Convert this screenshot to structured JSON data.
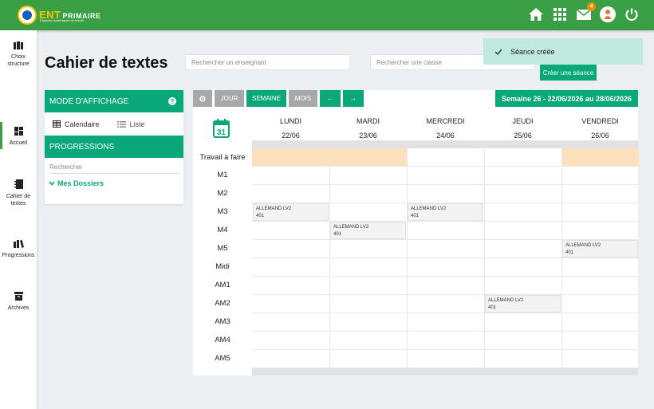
{
  "app": {
    "logo_main": "ENT",
    "logo_word": "PRIMAIRE",
    "logo_tagline": "Espaces numériques de travail",
    "mail_count": "4"
  },
  "sidebar": {
    "items": [
      {
        "label": "Choix structure",
        "icon": "building-icon"
      },
      {
        "label": "Accueil",
        "icon": "dashboard-icon"
      },
      {
        "label": "Cahier de textes",
        "icon": "notebook-icon"
      },
      {
        "label": "Progressions",
        "icon": "books-icon"
      },
      {
        "label": "Archives",
        "icon": "archive-icon"
      }
    ]
  },
  "page": {
    "title": "Cahier de textes",
    "search_teacher_placeholder": "Rechercher un enseignant",
    "search_class_placeholder": "Rechercher une classe",
    "toast": "Séance créée",
    "create_button": "Créer une séance"
  },
  "left_panel": {
    "mode_header": "MODE D'AFFICHAGE",
    "help": "?",
    "mode_calendar": "Calendaire",
    "mode_list": "Liste",
    "progressions_header": "PROGRESSIONS",
    "search_placeholder": "Rechercher",
    "folder": "Mes Dossiers"
  },
  "calendar": {
    "toolbar": {
      "day": "JOUR",
      "week": "SEMAINE",
      "month": "MOIS",
      "prev": "←",
      "next": "→"
    },
    "week_label": "Semaine 26 - 22/06/2026 au 28/06/2026",
    "days": [
      {
        "name": "LUNDI",
        "date": "22/06"
      },
      {
        "name": "MARDI",
        "date": "23/06"
      },
      {
        "name": "MERCREDI",
        "date": "24/06"
      },
      {
        "name": "JEUDI",
        "date": "25/06"
      },
      {
        "name": "VENDREDI",
        "date": "26/06"
      }
    ],
    "rows": [
      "Travail à faire",
      "M1",
      "M2",
      "M3",
      "M4",
      "M5",
      "Midi",
      "AM1",
      "AM2",
      "AM3",
      "AM4",
      "AM5"
    ],
    "events": [
      {
        "day": 0,
        "slot": "M3",
        "subject": "ALLEMAND LV2",
        "room": "401"
      },
      {
        "day": 1,
        "slot": "M4",
        "subject": "ALLEMAND LV2",
        "room": "401"
      },
      {
        "day": 2,
        "slot": "M3",
        "subject": "ALLEMAND LV2",
        "room": "401"
      },
      {
        "day": 4,
        "slot": "M5",
        "subject": "ALLEMAND LV2",
        "room": "401"
      },
      {
        "day": 3,
        "slot": "AM2",
        "subject": "ALLEMAND LV2",
        "room": "401"
      }
    ],
    "todo_colors": [
      "#fde1bd",
      "#fde1bd",
      "#ffffff",
      "#ffffff",
      "#fde1bd"
    ]
  }
}
